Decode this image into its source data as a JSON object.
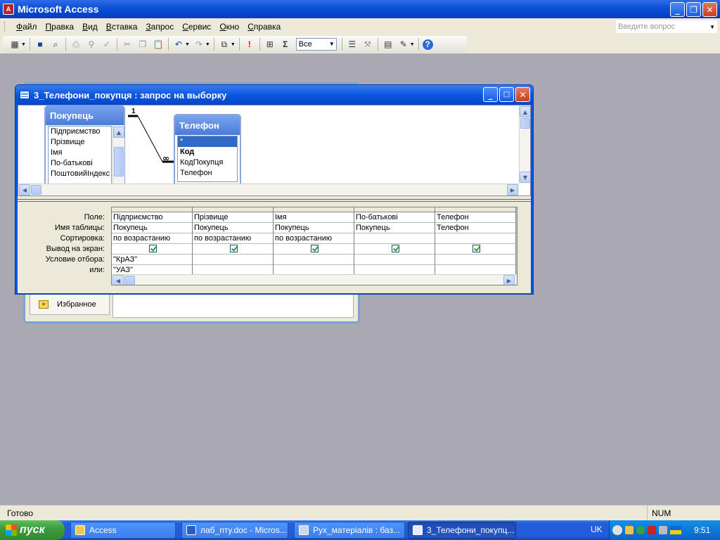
{
  "window": {
    "title": "Microsoft Access",
    "app_icon": "A"
  },
  "window_buttons": {
    "minimize": "_",
    "maximize": "❐",
    "close": "✕"
  },
  "menu": [
    {
      "label": "Файл",
      "key": "Ф",
      "rest": "айл"
    },
    {
      "label": "Правка",
      "key": "П",
      "rest": "равка"
    },
    {
      "label": "Вид",
      "key": "В",
      "rest": "ид"
    },
    {
      "label": "Вставка",
      "key": "В",
      "rest": "ставка"
    },
    {
      "label": "Запрос",
      "key": "З",
      "rest": "апрос"
    },
    {
      "label": "Сервис",
      "key": "С",
      "rest": "ервис"
    },
    {
      "label": "Окно",
      "key": "О",
      "rest": "кно"
    },
    {
      "label": "Справка",
      "key": "С",
      "rest": "правка"
    }
  ],
  "ask": {
    "placeholder": "Введите вопрос"
  },
  "toolbar": {
    "combo_value": "Все",
    "sigma": "Σ",
    "bang": "!",
    "help": "?"
  },
  "favorites_label": "Избранное",
  "query": {
    "title": "3_Телефони_покупця : запрос на выборку",
    "join": {
      "one": "1",
      "many": "∞"
    },
    "table1": {
      "name": "Покупець",
      "fields": [
        "Підприємство",
        "Прізвище",
        "Імя",
        "По-батькові",
        "ПоштовийІндекс"
      ]
    },
    "table2": {
      "name": "Телефон",
      "fields": [
        "*",
        "Код",
        "КодПокупця",
        "Телефон"
      ]
    }
  },
  "grid": {
    "row_labels": [
      "Поле:",
      "Имя таблицы:",
      "Сортировка:",
      "Вывод на экран:",
      "Условие отбора:",
      "или:"
    ],
    "columns": [
      {
        "field": "Підприємство",
        "table": "Покупець",
        "sort": "по возрастанию",
        "show": true,
        "criteria": "\"КрАЗ\"",
        "or": "\"УАЗ\""
      },
      {
        "field": "Прізвище",
        "table": "Покупець",
        "sort": "по возрастанию",
        "show": true,
        "criteria": "",
        "or": ""
      },
      {
        "field": "Імя",
        "table": "Покупець",
        "sort": "по возрастанию",
        "show": true,
        "criteria": "",
        "or": ""
      },
      {
        "field": "По-батькові",
        "table": "Покупець",
        "sort": "",
        "show": true,
        "criteria": "",
        "or": ""
      },
      {
        "field": "Телефон",
        "table": "Телефон",
        "sort": "",
        "show": true,
        "criteria": "",
        "or": ""
      }
    ]
  },
  "status": {
    "text": "Готово",
    "num": "NUM"
  },
  "taskbar": {
    "start": "пуск",
    "buttons": [
      "Access",
      "лаб_пту.doc - Micros...",
      "Рух_матеріалів : баз...",
      "3_Телефони_покупц..."
    ],
    "lang": "UK",
    "time": "9:51"
  }
}
